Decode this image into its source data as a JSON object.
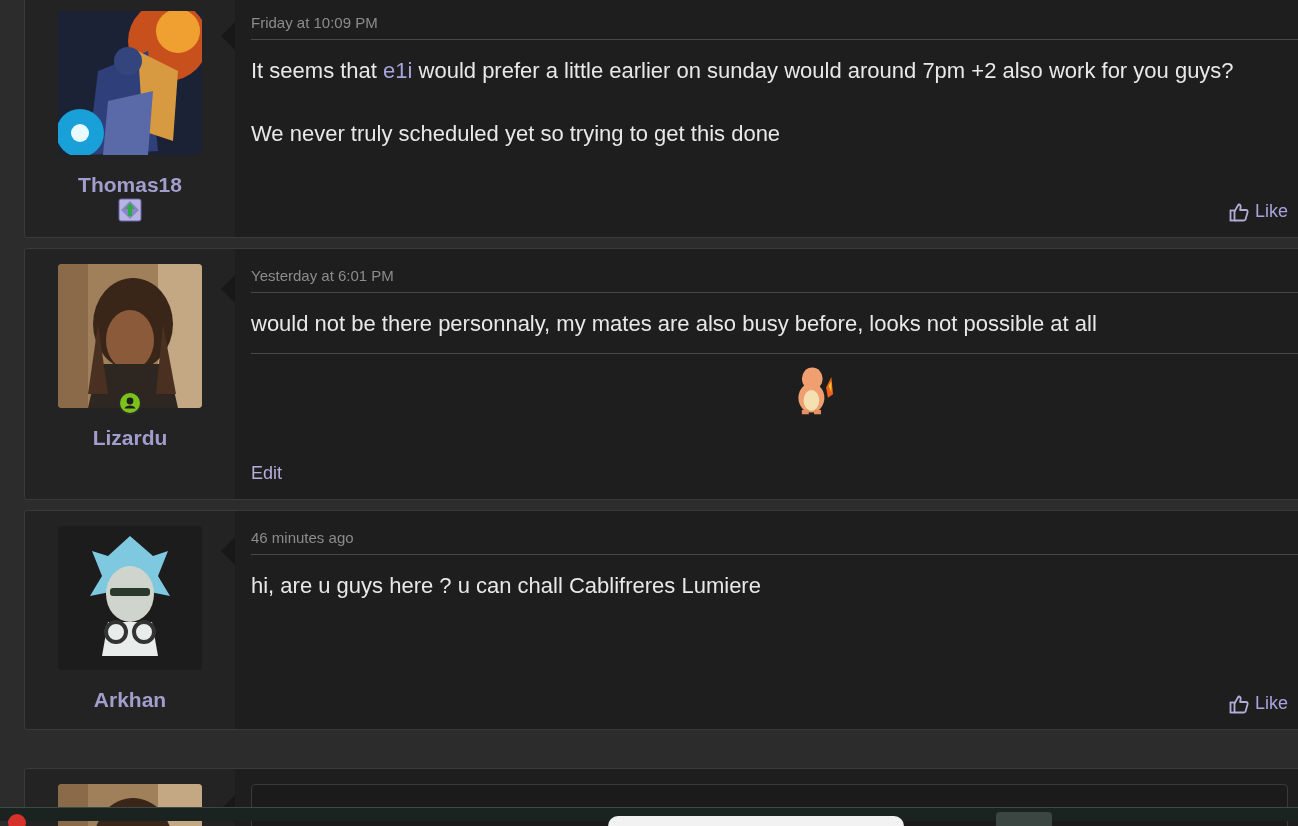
{
  "posts": [
    {
      "author": "Thomas18",
      "avatar": {
        "kind": "picture"
      },
      "rank_badge": true,
      "online": false,
      "date": "Friday at 10:09 PM",
      "paragraphs": [
        [
          {
            "text": "It seems that "
          },
          {
            "text": "e1i",
            "kind": "mention"
          },
          {
            "text": " would prefer a little earlier on sunday would around 7pm +2 also work for you guys?"
          }
        ],
        [
          {
            "text": "We never truly scheduled yet so trying to get this done"
          }
        ]
      ],
      "actions": [
        {
          "label": "Like",
          "kind": "like"
        }
      ]
    },
    {
      "author": "Lizardu",
      "avatar": {
        "kind": "picture"
      },
      "rank_badge": false,
      "online": true,
      "date": "Yesterday at 6:01 PM",
      "paragraphs": [
        [
          {
            "text": "would not be there personnaly, my mates are also busy before, looks not possible at all"
          }
        ]
      ],
      "signature": {
        "kind": "picture"
      },
      "actions": [
        {
          "label": "Edit",
          "kind": "edit"
        }
      ]
    },
    {
      "author": "Arkhan",
      "avatar": {
        "kind": "picture"
      },
      "rank_badge": false,
      "online": false,
      "date": "46 minutes ago",
      "paragraphs": [
        [
          {
            "text": "hi, are u guys here ? u can chall Cablifreres Lumiere"
          }
        ]
      ],
      "actions": [
        {
          "label": "Like",
          "kind": "like"
        }
      ]
    }
  ],
  "reply_editor": {
    "avatar": {
      "kind": "picture"
    }
  }
}
